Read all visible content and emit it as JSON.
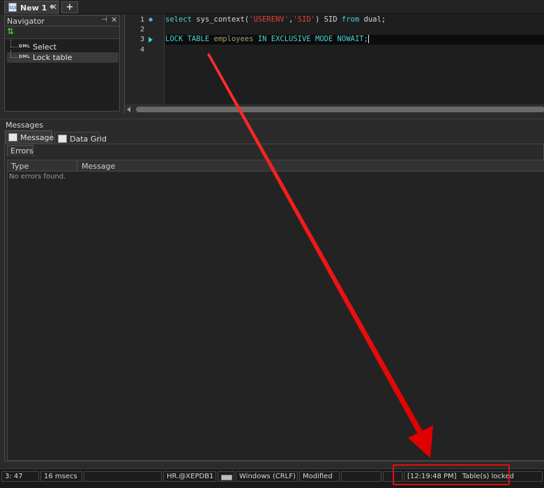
{
  "editor_tab": {
    "title": "New 1 *",
    "icon": "sql-file-icon",
    "close": "✕",
    "add": "+"
  },
  "navigator": {
    "title": "Navigator",
    "pin": "⊣",
    "close": "✕",
    "items": [
      {
        "tag": "DML",
        "label": "Select"
      },
      {
        "tag": "DML",
        "label": "Lock table"
      }
    ]
  },
  "editor": {
    "line_numbers": [
      "1",
      "2",
      "3",
      "4"
    ],
    "line1": {
      "kw1": "select ",
      "fn": "sys_context(",
      "s1": "'USERENV'",
      "comma": ",",
      "s2": "'SID'",
      "rest1": ") SID ",
      "kw2": "from",
      "rest2": " dual;"
    },
    "line3": {
      "kw1": "LOCK TABLE ",
      "ident": "employees",
      "kw2": " IN EXCLUSIVE MODE NOWAIT;"
    }
  },
  "messages": {
    "header": "Messages",
    "tabs": [
      {
        "label": "Messages"
      },
      {
        "label": "Data Grid"
      }
    ],
    "sub_tab": "Errors",
    "columns": [
      "Type",
      "Message"
    ],
    "empty_text": "No errors found."
  },
  "status": {
    "position": "3:  47",
    "elapsed": "16 msecs",
    "connection": "HR.@XEPDB1",
    "line_endings": "Windows (CRLF)",
    "state": "Modified",
    "message_time": "[12:19:48 PM]",
    "message_text": "Table(s) locked"
  },
  "colors": {
    "annotation": "#e01010",
    "keyword": "#4fd0d0",
    "string": "#e04040"
  }
}
